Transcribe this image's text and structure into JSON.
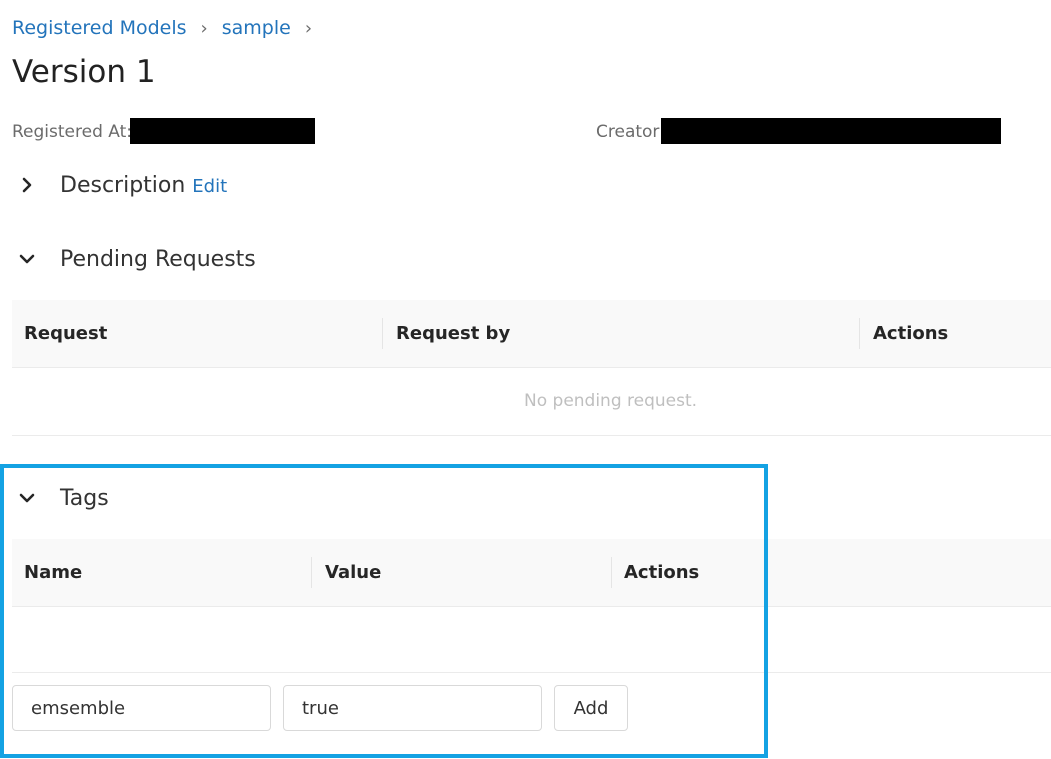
{
  "breadcrumb": {
    "items": [
      "Registered Models",
      "sample"
    ],
    "separator": "›"
  },
  "page": {
    "title": "Version 1"
  },
  "metadata": {
    "registered_at_label": "Registered At:",
    "creator_label": "Creator:"
  },
  "description_section": {
    "title": "Description",
    "edit_label": "Edit",
    "collapsed": true
  },
  "pending_requests": {
    "title": "Pending Requests",
    "columns": [
      "Request",
      "Request by",
      "Actions"
    ],
    "empty_text": "No pending request."
  },
  "tags": {
    "title": "Tags",
    "columns": [
      "Name",
      "Value",
      "Actions"
    ],
    "name_input_value": "emsemble",
    "value_input_value": "true",
    "add_label": "Add"
  },
  "colors": {
    "link": "#2374bb",
    "highlight_border": "#14a2e3",
    "redacted": "#000000"
  }
}
